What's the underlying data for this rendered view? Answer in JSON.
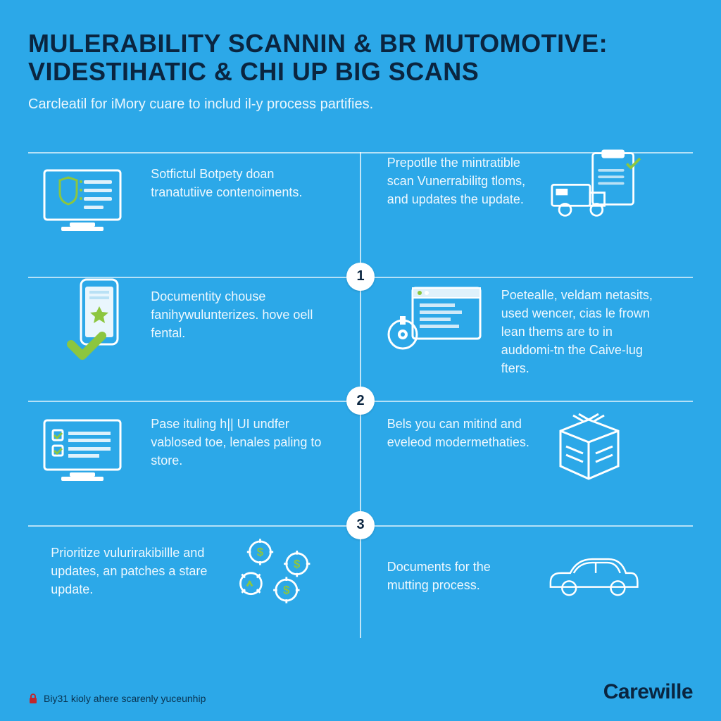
{
  "colors": {
    "bg": "#2CA8E8",
    "accent": "#8CC63F",
    "dark": "#0a2540",
    "white": "#ffffff"
  },
  "title_line1": "MULERABILITY SCANNIN & BR MUTOMOTIVE:",
  "title_line2": "VIDESTIHATIC & CHI UP BIG SCANS",
  "subtitle": "Carcleatil for iMory cuare to includ il-y process partifies.",
  "cells": {
    "r1l": "Sotfictul Botpety doan tranatutiive contenoiments.",
    "r1r": "Prepotlle the mintratible scan Vunerrabilitg tloms, and updates the update.",
    "r2l": "Documentity chouse fanihywulunterizes. hove oell fental.",
    "r2r": "Poetealle, veldam netasits, used wencer, cias le frown lean thems are to in auddomi-tn the Caive-lug fters.",
    "r3l": "Pase ituling h|| UI undfer vablosed toe, lenales paling to store.",
    "r3r": "Bels you can mitind and eveleod modermethaties.",
    "r4l": "Prioritize vulurirakibillle and updates, an patches a stare update.",
    "r4r": "Documents for the mutting process."
  },
  "numbers": {
    "n1": "1",
    "n2": "2",
    "n3": "3"
  },
  "footnote": "Biy31 kioly ahere scarenly yuceunhip",
  "brand": "Carewille",
  "icons": {
    "monitor_shield": "monitor-shield-icon",
    "clipboard_truck": "clipboard-truck-icon",
    "phone_star": "phone-star-icon",
    "browser_dial": "browser-dial-icon",
    "monitor_check": "monitor-checklist-icon",
    "box": "box-icon",
    "dollar_gears": "dollar-gears-icon",
    "car": "car-icon",
    "lock": "lock-icon"
  }
}
